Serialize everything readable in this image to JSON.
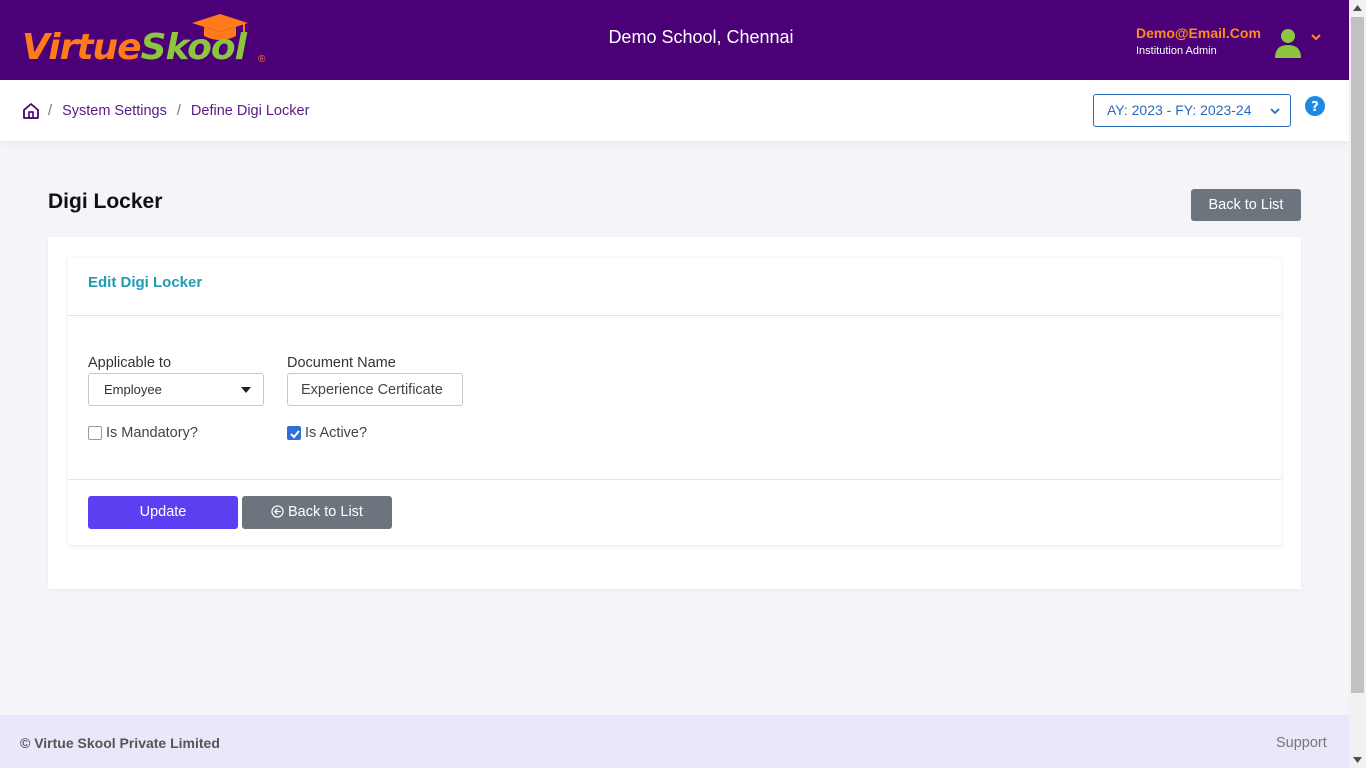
{
  "header": {
    "logo": {
      "part1": "Virtue",
      "part2": "Skool",
      "reg": "®"
    },
    "school_name": "Demo School, Chennai",
    "user": {
      "email": "Demo@Email.Com",
      "role": "Institution Admin"
    }
  },
  "breadcrumb": {
    "items": [
      "System Settings",
      "Define Digi Locker"
    ],
    "separator": "/"
  },
  "fy_selector": {
    "value": "AY: 2023 - FY: 2023-24"
  },
  "page": {
    "title": "Digi Locker",
    "back_button": "Back to List"
  },
  "form": {
    "card_title": "Edit Digi Locker",
    "applicable_to": {
      "label": "Applicable to",
      "value": "Employee"
    },
    "document_name": {
      "label": "Document Name",
      "value": "Experience Certificate"
    },
    "is_mandatory": {
      "label": "Is Mandatory?",
      "checked": false
    },
    "is_active": {
      "label": "Is Active?",
      "checked": true
    },
    "update_button": "Update",
    "back_button": "Back to List"
  },
  "footer": {
    "copyright": "© Virtue Skool Private Limited",
    "support": "Support"
  },
  "colors": {
    "header_bg": "#4b0077",
    "logo_orange": "#ff7a1a",
    "logo_green": "#8cc63f",
    "accent_teal": "#1f9bb3",
    "update_button": "#5b3ff0",
    "secondary_button": "#6c757d",
    "footer_bg": "#ebe7fb"
  }
}
